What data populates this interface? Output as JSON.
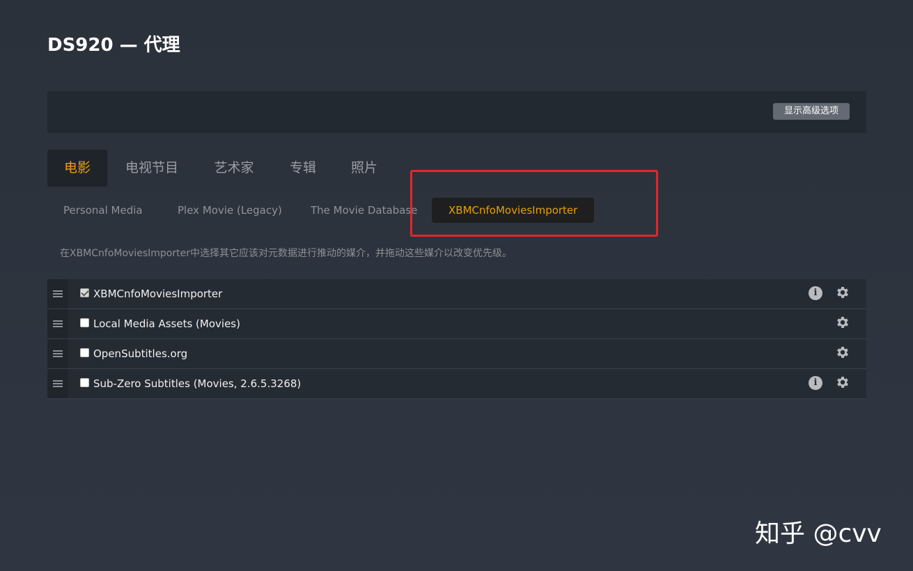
{
  "page": {
    "title": "DS920 — 代理"
  },
  "toolbar": {
    "advanced_button": "显示高级选项"
  },
  "tabs": [
    {
      "label": "电影",
      "active": true
    },
    {
      "label": "电视节目",
      "active": false
    },
    {
      "label": "艺术家",
      "active": false
    },
    {
      "label": "专辑",
      "active": false
    },
    {
      "label": "照片",
      "active": false
    }
  ],
  "agent_tabs": [
    {
      "label": "Personal Media",
      "active": false
    },
    {
      "label": "Plex Movie (Legacy)",
      "active": false
    },
    {
      "label": "The Movie Database",
      "active": false
    },
    {
      "label": "XBMCnfoMoviesImporter",
      "active": true
    }
  ],
  "description": "在XBMCnfoMoviesImporter中选择其它应该对元数据进行推动的媒介，并拖动这些媒介以改变优先级。",
  "agents": [
    {
      "label": "XBMCnfoMoviesImporter",
      "checked": true,
      "has_info": true,
      "has_settings": true
    },
    {
      "label": "Local Media Assets (Movies)",
      "checked": false,
      "has_info": false,
      "has_settings": true
    },
    {
      "label": "OpenSubtitles.org",
      "checked": false,
      "has_info": false,
      "has_settings": true
    },
    {
      "label": "Sub-Zero Subtitles (Movies, 2.6.5.3268)",
      "checked": false,
      "has_info": true,
      "has_settings": true
    }
  ],
  "icons": {
    "info": "info-icon",
    "settings": "gear-icon",
    "drag": "drag-handle-icon"
  },
  "colors": {
    "accent": "#e5a00d",
    "highlight_box": "#e4262a"
  },
  "watermark": "知乎 @cvv"
}
